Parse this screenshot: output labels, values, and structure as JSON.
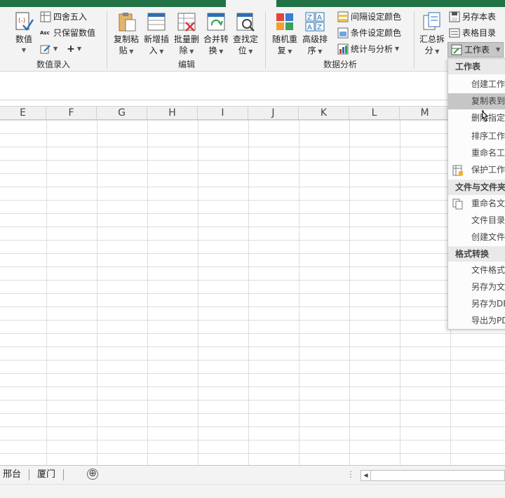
{
  "ribbon": {
    "numeric_group": {
      "label": "数值录入",
      "value_button": "数值",
      "round_button": "四舍五入",
      "keep_value_button": "只保留数值",
      "asc_icon_text": "Asc",
      "plus_text": "+"
    },
    "edit_group": {
      "label": "编辑",
      "buttons": [
        "复制粘贴",
        "新增插入",
        "批量删除",
        "合并转换",
        "查找定位"
      ],
      "buttons_line1": [
        "复制粘",
        "新增插",
        "批量删",
        "合并转",
        "查找定"
      ],
      "buttons_line2": [
        "贴",
        "入",
        "除",
        "换",
        "位"
      ]
    },
    "analysis_group": {
      "label": "数据分析",
      "random_line1": "随机重",
      "random_line2": "复",
      "sort_line1": "高级排",
      "sort_line2": "序",
      "interval_color": "间隔设定颜色",
      "cond_color": "条件设定颜色",
      "stats": "统计与分析"
    },
    "summary_group": {
      "split_line1": "汇总拆",
      "split_line2": "分",
      "save_sheet": "另存本表",
      "sheet_dir": "表格目录",
      "worksheet": "工作表"
    }
  },
  "columns": [
    "E",
    "F",
    "G",
    "H",
    "I",
    "J",
    "K",
    "L",
    "M"
  ],
  "sheet_tabs": [
    "邢台",
    "厦门"
  ],
  "add_sheet_symbol": "⊕",
  "scroll_dots": "⋮",
  "scroll_left_arrow": "◀",
  "menu": {
    "sections": [
      {
        "title": "工作表",
        "items": [
          "创建工作",
          "复制表到",
          "删除指定",
          "排序工作",
          "重命名工",
          "保护工作"
        ]
      },
      {
        "title": "文件与文件夹",
        "items": [
          "重命名文",
          "文件目录",
          "创建文件"
        ]
      },
      {
        "title": "格式转换",
        "items": [
          "文件格式",
          "另存为文",
          "另存为DE",
          "导出为PD"
        ]
      }
    ],
    "hover_item": "复制表到"
  },
  "colors": {
    "accent": "#217346",
    "ribbon_bg": "#f3f3f3",
    "menu_hover": "#c6c6c6"
  }
}
